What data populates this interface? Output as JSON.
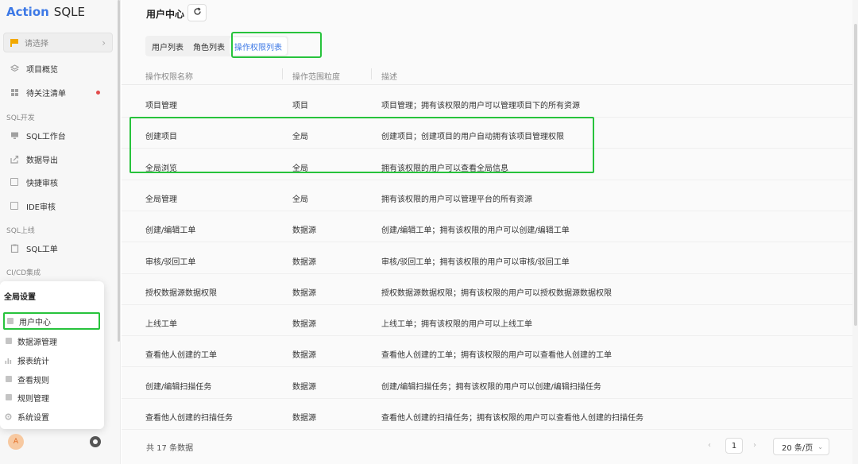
{
  "logo": {
    "brand": "Action",
    "product": "SQLE"
  },
  "sidebar": {
    "project_select": {
      "placeholder": "请选择"
    },
    "top_items": [
      {
        "label": "项目概览",
        "icon": "layers-icon"
      },
      {
        "label": "待关注清单",
        "icon": "grid-icon"
      }
    ],
    "groups": [
      {
        "title": "SQL开发",
        "items": [
          {
            "label": "SQL工作台",
            "icon": "monitor-icon"
          },
          {
            "label": "数据导出",
            "icon": "export-icon"
          },
          {
            "label": "快捷审核",
            "icon": "file-icon"
          },
          {
            "label": "IDE审核",
            "icon": "ide-icon"
          }
        ]
      },
      {
        "title": "SQL上线",
        "items": [
          {
            "label": "SQL工单",
            "icon": "clipboard-icon"
          }
        ]
      },
      {
        "title": "CI/CD集成",
        "items": []
      }
    ],
    "avatar_initial": "A"
  },
  "popup": {
    "title": "全局设置",
    "items": [
      {
        "label": "用户中心",
        "icon": "user-icon",
        "active": true
      },
      {
        "label": "数据源管理",
        "icon": "database-icon"
      },
      {
        "label": "报表统计",
        "icon": "chart-icon"
      },
      {
        "label": "查看规则",
        "icon": "rule-icon"
      },
      {
        "label": "规则管理",
        "icon": "rule-manage-icon"
      },
      {
        "label": "系统设置",
        "icon": "gear-icon"
      }
    ]
  },
  "main": {
    "title": "用户中心",
    "tabs": [
      {
        "label": "用户列表"
      },
      {
        "label": "角色列表"
      },
      {
        "label": "操作权限列表",
        "active": true
      }
    ],
    "table": {
      "columns": [
        "操作权限名称",
        "操作范围粒度",
        "描述"
      ],
      "rows": [
        [
          "项目管理",
          "项目",
          "项目管理；拥有该权限的用户可以管理项目下的所有资源"
        ],
        [
          "创建项目",
          "全局",
          "创建项目；创建项目的用户自动拥有该项目管理权限"
        ],
        [
          "全局浏览",
          "全局",
          "拥有该权限的用户可以查看全局信息"
        ],
        [
          "全局管理",
          "全局",
          "拥有该权限的用户可以管理平台的所有资源"
        ],
        [
          "创建/编辑工单",
          "数据源",
          "创建/编辑工单；拥有该权限的用户可以创建/编辑工单"
        ],
        [
          "审核/驳回工单",
          "数据源",
          "审核/驳回工单；拥有该权限的用户可以审核/驳回工单"
        ],
        [
          "授权数据源数据权限",
          "数据源",
          "授权数据源数据权限；拥有该权限的用户可以授权数据源数据权限"
        ],
        [
          "上线工单",
          "数据源",
          "上线工单；拥有该权限的用户可以上线工单"
        ],
        [
          "查看他人创建的工单",
          "数据源",
          "查看他人创建的工单；拥有该权限的用户可以查看他人创建的工单"
        ],
        [
          "创建/编辑扫描任务",
          "数据源",
          "创建/编辑扫描任务；拥有该权限的用户可以创建/编辑扫描任务"
        ],
        [
          "查看他人创建的扫描任务",
          "数据源",
          "查看他人创建的扫描任务；拥有该权限的用户可以查看他人创建的扫描任务"
        ]
      ]
    },
    "footer": {
      "total": "共 17 条数据",
      "page": "1",
      "page_size": "20 条/页"
    }
  },
  "colors": {
    "accent": "#3d79e6",
    "highlight": "#27c33c",
    "badge": "#e24c4c"
  }
}
